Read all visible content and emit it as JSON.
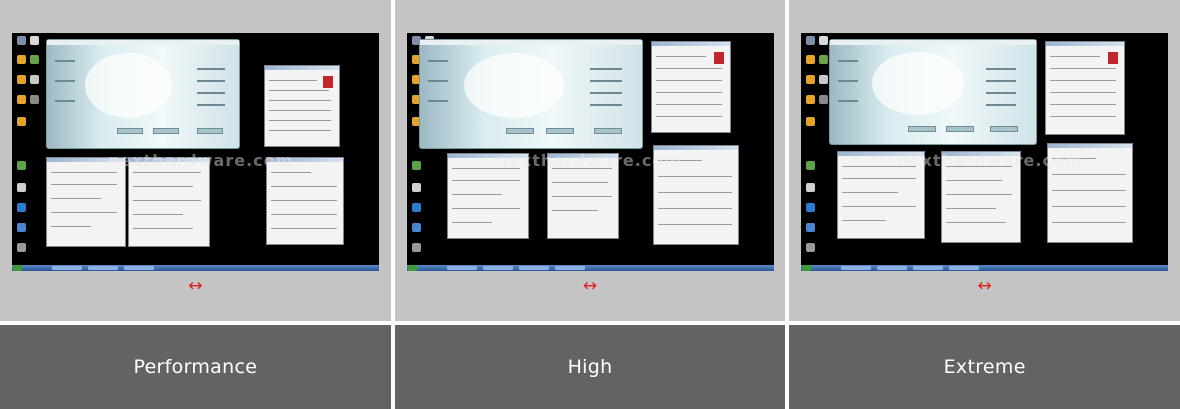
{
  "gallery": {
    "items": [
      {
        "caption": "Performance",
        "expand_icon": "↔",
        "watermark": "nexthardware.com"
      },
      {
        "caption": "High",
        "expand_icon": "↔",
        "watermark": "nexthardware.com"
      },
      {
        "caption": "Extreme",
        "expand_icon": "↔",
        "watermark": "nexthardware.com"
      }
    ]
  },
  "colors": {
    "panel_bg": "#c4c4c4",
    "caption_bg": "#636363",
    "caption_text": "#ffffff",
    "expand_icon": "#e02020",
    "desktop_bg": "#000000"
  }
}
